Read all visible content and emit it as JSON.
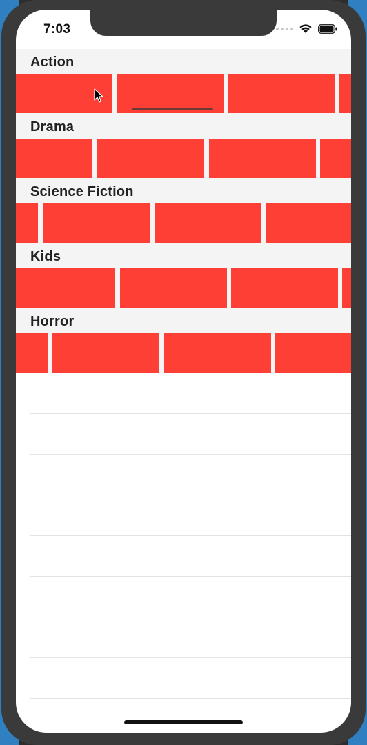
{
  "status_bar": {
    "time": "7:03",
    "icons": [
      "signal-dots-icon",
      "wifi-icon",
      "battery-icon"
    ]
  },
  "colors": {
    "tile": "#fd3f36",
    "row_background": "#f4f4f4",
    "screen_background": "#ffffff"
  },
  "categories": [
    {
      "title": "Action"
    },
    {
      "title": "Drama"
    },
    {
      "title": "Science Fiction"
    },
    {
      "title": "Kids"
    },
    {
      "title": "Horror"
    }
  ]
}
